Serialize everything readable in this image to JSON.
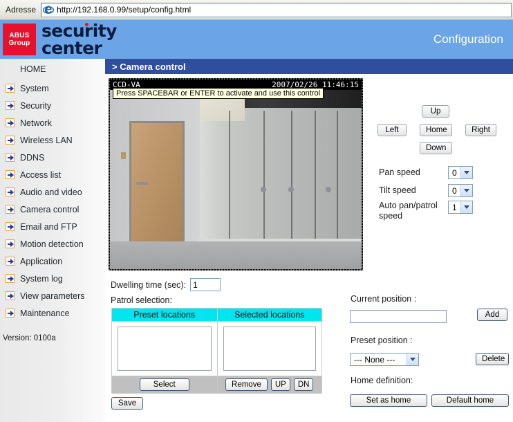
{
  "browser": {
    "address_label": "Adresse",
    "url": "http://192.168.0.99/setup/config.html",
    "icon": "ie-logo-icon"
  },
  "header": {
    "logo_line1": "ABUS",
    "logo_line2": "Group",
    "brand_line1": "security",
    "brand_line2": "center",
    "mode_title": "Configuration"
  },
  "sidebar": {
    "items": [
      {
        "label": "HOME",
        "icon": null
      },
      {
        "label": "System",
        "icon": "arrow-icon"
      },
      {
        "label": "Security",
        "icon": "arrow-icon"
      },
      {
        "label": "Network",
        "icon": "arrow-icon"
      },
      {
        "label": "Wireless LAN",
        "icon": "arrow-icon"
      },
      {
        "label": "DDNS",
        "icon": "arrow-icon"
      },
      {
        "label": "Access list",
        "icon": "arrow-icon"
      },
      {
        "label": "Audio and video",
        "icon": "arrow-icon"
      },
      {
        "label": "Camera control",
        "icon": "arrow-icon"
      },
      {
        "label": "Email and FTP",
        "icon": "arrow-icon"
      },
      {
        "label": "Motion detection",
        "icon": "arrow-icon"
      },
      {
        "label": "Application",
        "icon": "arrow-icon"
      },
      {
        "label": "System log",
        "icon": "arrow-icon"
      },
      {
        "label": "View parameters",
        "icon": "arrow-icon"
      },
      {
        "label": "Maintenance",
        "icon": "arrow-icon"
      }
    ],
    "version": "Version: 0100a"
  },
  "page": {
    "title": "> Camera control"
  },
  "video": {
    "osd_left": "CCD-VA",
    "osd_right": "2007/02/26 11:46:15",
    "tooltip": "Press SPACEBAR or ENTER to activate and use this control"
  },
  "ptz": {
    "up": "Up",
    "left": "Left",
    "home": "Home",
    "right": "Right",
    "down": "Down",
    "pan_speed_label": "Pan speed",
    "pan_speed_value": "0",
    "tilt_speed_label": "Tilt speed",
    "tilt_speed_value": "0",
    "auto_speed_label": "Auto pan/patrol speed",
    "auto_speed_value": "1"
  },
  "patrol": {
    "dwelling_label": "Dwelling time (sec):",
    "dwelling_value": "1",
    "selection_label": "Patrol selection:",
    "preset_header": "Preset locations",
    "selected_header": "Selected locations",
    "preset_items": [],
    "selected_items": [],
    "select_btn": "Select",
    "remove_btn": "Remove",
    "up_btn": "UP",
    "dn_btn": "DN",
    "save_btn": "Save"
  },
  "position": {
    "current_label": "Current position :",
    "current_value": "",
    "add_btn": "Add",
    "preset_label": "Preset position :",
    "preset_value": "--- None ---",
    "delete_btn": "Delete",
    "home_def_label": "Home definition:",
    "set_home_btn": "Set as home",
    "default_home_btn": "Default home"
  },
  "colors": {
    "brand_bar": "#6ba5e7",
    "title_band": "#2f4f9e",
    "logo_red": "#e8112d",
    "header_cyan": "#00e5ee",
    "icon_orange": "#e8a33d",
    "icon_blue": "#2a3a9c"
  }
}
